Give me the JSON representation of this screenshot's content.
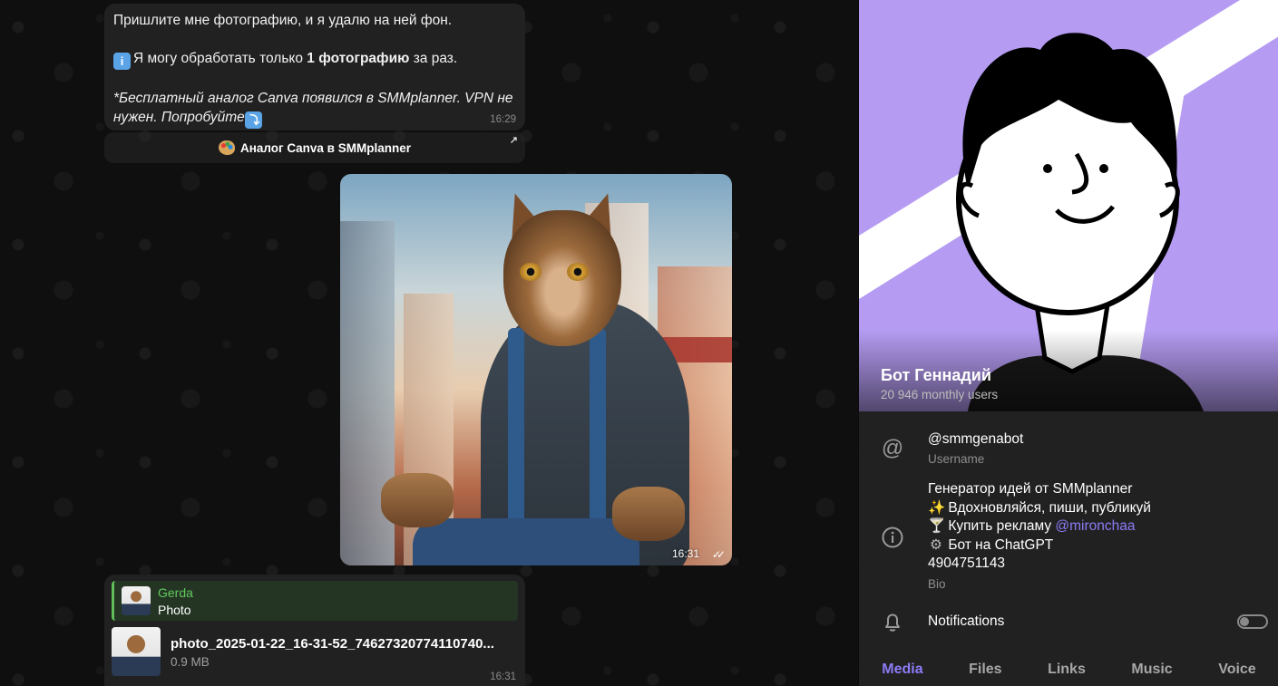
{
  "messages": {
    "intro": {
      "line1": "Пришлите мне фотографию, и я удалю на ней фон.",
      "line2_prefix": "Я могу обработать только ",
      "line2_bold": "1 фотографию",
      "line2_suffix": " за раз.",
      "line3": "*Бесплатный аналог Canva появился в SMMplanner. VPN не нужен. Попробуйте",
      "info_emoji": "i",
      "down_emoji": "⤵",
      "time": "16:29"
    },
    "inline_button": {
      "label": "Аналог Canva в SMMplanner",
      "icon": "palette-icon",
      "arrow": "↗"
    },
    "photo": {
      "time": "16:31",
      "status": "read-double-check"
    },
    "file": {
      "reply_name": "Gerda",
      "reply_text": "Photo",
      "file_name": "photo_2025-01-22_16-31-52_74627320774110740...",
      "file_size": "0.9 MB",
      "time": "16:31"
    }
  },
  "profile": {
    "name": "Бот Геннадий",
    "users": "20 946 monthly users",
    "username": "@smmgenabot",
    "username_label": "Username",
    "bio_lines": [
      {
        "emoji": "",
        "text": "Генератор идей от SMMplanner"
      },
      {
        "emoji": "✨",
        "text": "Вдохновляйся, пиши, публикуй"
      },
      {
        "emoji": "🍸",
        "text": "Купить рекламу ",
        "link": "@mironchaa"
      },
      {
        "emoji": "⚙",
        "text": "Бот на ChatGPT"
      },
      {
        "emoji": "",
        "text": "4904751143"
      }
    ],
    "bio_label": "Bio",
    "notifications_label": "Notifications",
    "notifications_on": false
  },
  "tabs": [
    {
      "label": "Media",
      "active": true
    },
    {
      "label": "Files",
      "active": false
    },
    {
      "label": "Links",
      "active": false
    },
    {
      "label": "Music",
      "active": false
    },
    {
      "label": "Voice",
      "active": false
    }
  ],
  "colors": {
    "accent": "#8b7cf6",
    "avatar_bg": "#b59cf2",
    "reply_green": "#62c95c",
    "bubble": "#212121"
  }
}
